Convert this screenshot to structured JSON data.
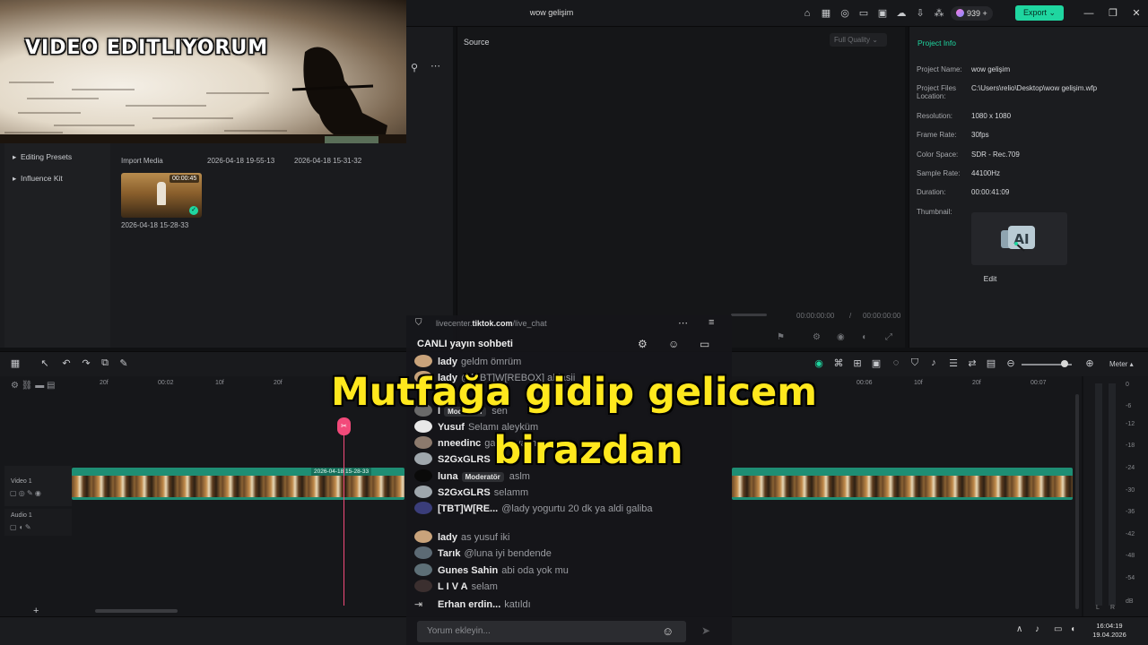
{
  "window": {
    "project_title": "wow gelişim",
    "credits": "939",
    "export_label": "Export"
  },
  "sidebar": {
    "items": [
      "Editing Presets",
      "Influence Kit"
    ]
  },
  "media": {
    "import_label": "Import Media",
    "thumbs": [
      "2026-04-18 19-55-13",
      "2026-04-18 15-31-32",
      "2026-04-18 15-28-33"
    ],
    "duration": "00:00:45"
  },
  "source": {
    "title": "Source",
    "quality": "Full Quality",
    "current_time": "00:00:00:00",
    "separator": "/",
    "total_time": "00:00:00:00"
  },
  "project_info": {
    "title": "Project Info",
    "rows": [
      {
        "label": "Project Name:",
        "value": "wow gelişim"
      },
      {
        "label": "Project Files Location:",
        "value": "C:\\Users\\relio\\Desktop\\wow gelişim.wfp"
      },
      {
        "label": "Resolution:",
        "value": "1080 x 1080"
      },
      {
        "label": "Frame Rate:",
        "value": "30fps"
      },
      {
        "label": "Color Space:",
        "value": "SDR - Rec.709"
      },
      {
        "label": "Sample Rate:",
        "value": "44100Hz"
      },
      {
        "label": "Duration:",
        "value": "00:00:41:09"
      },
      {
        "label": "Thumbnail:",
        "value": ""
      }
    ],
    "edit_label": "Edit"
  },
  "timeline": {
    "ruler": [
      "20f",
      "00:02",
      "10f",
      "20f",
      "00:06",
      "10f",
      "20f",
      "00:07"
    ],
    "tracks": [
      "Video 1",
      "Audio 1"
    ],
    "clip_label": "2026-04-18 15-28-33",
    "meter_label": "Meter",
    "meter_scale": [
      "0",
      "-6",
      "-12",
      "-18",
      "-24",
      "-30",
      "-36",
      "-42",
      "-48",
      "-54",
      "dB"
    ],
    "meter_channels": [
      "L",
      "R"
    ]
  },
  "stream": {
    "cam_title": "VIDEO EDITLIYORUM",
    "caption_line1": "Mutfağa gidip gelicem",
    "caption_line2": "birazdan"
  },
  "chat": {
    "url_prefix": "livecenter.",
    "url_domain": "tiktok.com",
    "url_path": "/live_chat",
    "title": "CANLI yayın sohbeti",
    "input_placeholder": "Yorum ekleyin...",
    "messages": [
      {
        "name": "lady",
        "badge": "",
        "text": "geldm ömrüm"
      },
      {
        "name": "lady",
        "badge": "",
        "text": "@[TBT]W[REBOX] ablasii"
      },
      {
        "name": "l",
        "badge": "Moderatör",
        "text": "sen"
      },
      {
        "name": "Yusuf",
        "badge": "",
        "text": "Selamı aleyküm"
      },
      {
        "name": "nneedinc",
        "badge": "",
        "text": "galaxy yazmıyor mu"
      },
      {
        "name": "S2GxGLRS",
        "badge": "",
        "text": ""
      },
      {
        "name": "luna",
        "badge": "Moderatör",
        "text": "aslm"
      },
      {
        "name": "S2GxGLRS",
        "badge": "",
        "text": "selamm"
      },
      {
        "name": "[TBT]W[RE...",
        "badge": "",
        "text": "@lady yogurtu 20 dk ya aldi galiba"
      },
      {
        "name": "lady",
        "badge": "",
        "text": "as yusuf iki"
      },
      {
        "name": "Tarık",
        "badge": "",
        "text": "@luna iyi bendende"
      },
      {
        "name": "Gunes Sahin",
        "badge": "",
        "text": "abi oda yok mu"
      },
      {
        "name": "L I V A",
        "badge": "",
        "text": "selam"
      },
      {
        "name": "Erhan erdin...",
        "badge": "",
        "text": "katıldı"
      }
    ]
  },
  "taskbar": {
    "time": "16:04:19",
    "date": "19.04.2026"
  },
  "colors": {
    "accent": "#1fd6a0",
    "caption": "#ffe81d",
    "playhead": "#f24a7a"
  }
}
